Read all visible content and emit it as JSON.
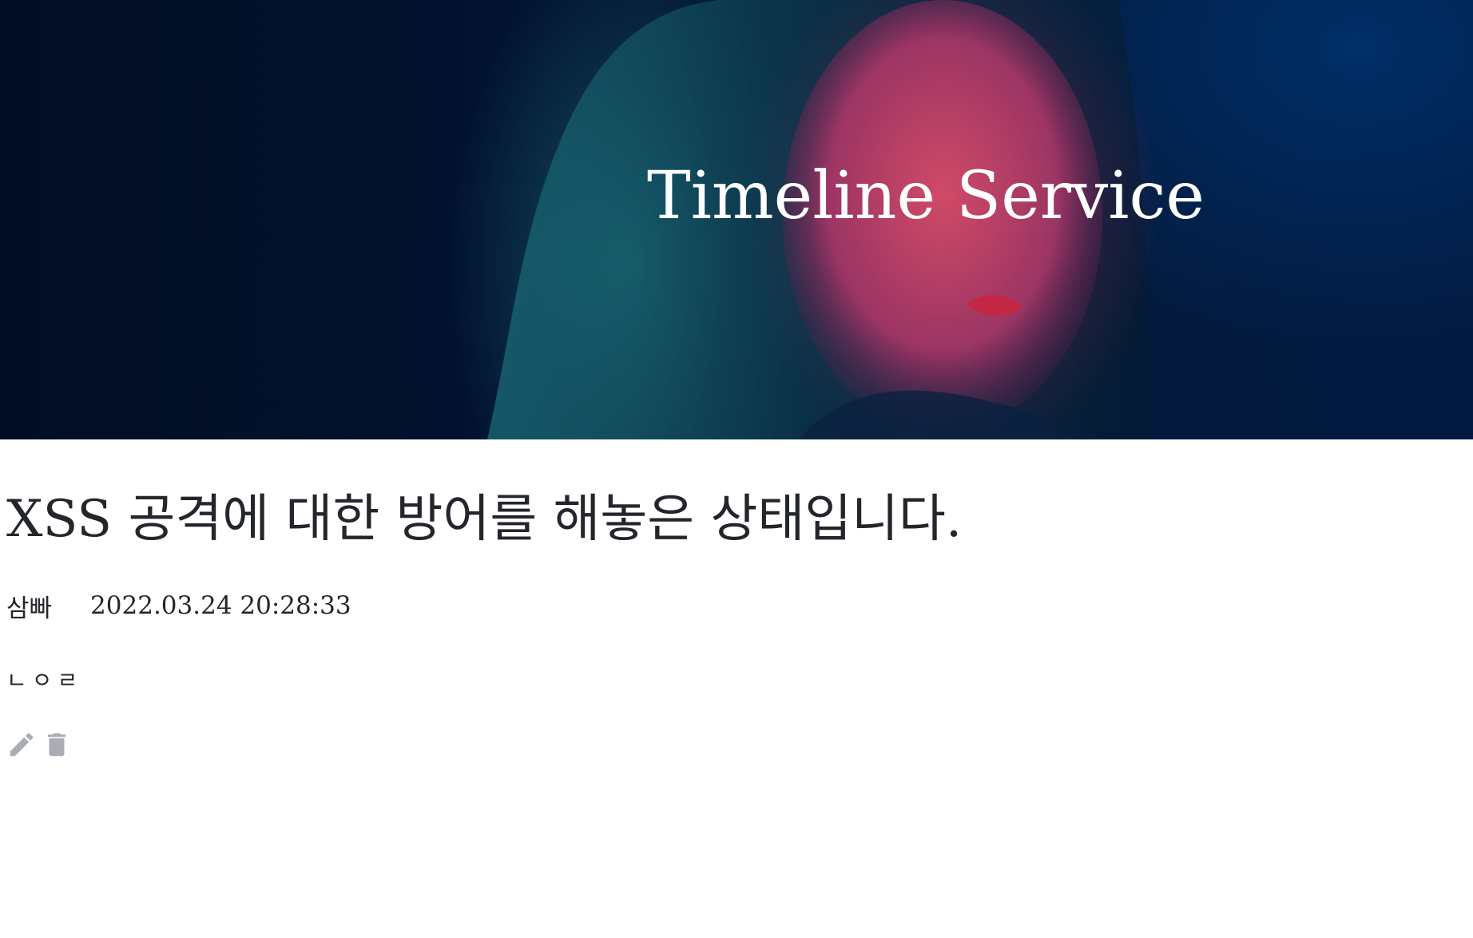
{
  "header": {
    "title": "Timeline Service"
  },
  "post": {
    "title": "XSS 공격에 대한 방어를 해놓은 상태입니다.",
    "author": "삼빠",
    "datetime": "2022.03.24 20:28:33",
    "body": "ㄴㅇㄹ",
    "actions": {
      "edit_icon": "pencil-icon",
      "delete_icon": "trash-icon",
      "icon_color": "#a9adb4"
    }
  }
}
